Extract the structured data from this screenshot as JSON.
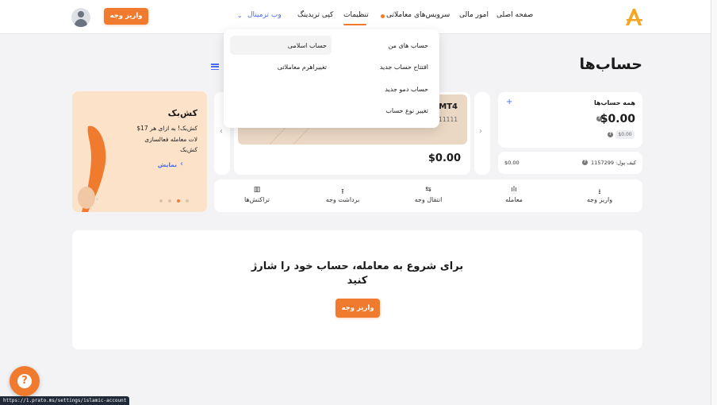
{
  "header": {
    "logo_letter": "A",
    "nav": {
      "home": "صفحه اصلی",
      "finance": "امور مالی",
      "trading_services": "سرویس‌های معاملاتی",
      "settings": "تنظیمات",
      "copy_trading": "کپی تریدینگ",
      "web_terminal": "وب ترمینال"
    },
    "deposit_button": "واریز وجه"
  },
  "page": {
    "title": "حساب‌ها"
  },
  "settings_dropdown": {
    "items_right": [
      "حساب های من",
      "افتتاح حساب جدید",
      "حساب دمو جدید",
      "تغییر نوع حساب"
    ],
    "items_left": [
      "حساب اسلامی",
      "تغییراهرم معاملاتی"
    ]
  },
  "accounts_summary": {
    "title": "همه حساب‌ها",
    "add_symbol": "+",
    "total": "$0.00",
    "chip": "$0.00",
    "wallet_label": "کیف پول: 1157299",
    "wallet_value": "$0.00"
  },
  "account_card": {
    "platform": "MT4",
    "number": "11111",
    "balance": "$0.00"
  },
  "cashback": {
    "title": "کش‌بک",
    "text_line1": "$17 کش‌بک! به ازای هر",
    "text_line2": "لات معامله فعالسازی",
    "text_line3": "کش‌بک",
    "show_link": "نمایش"
  },
  "actions": [
    {
      "label": "واریز وجه",
      "icon": "download-icon"
    },
    {
      "label": "معامله",
      "icon": "candles-icon"
    },
    {
      "label": "انتقال وجه",
      "icon": "transfer-icon"
    },
    {
      "label": "برداشت وجه",
      "icon": "upload-icon"
    },
    {
      "label": "تراکنش‌ها",
      "icon": "trash-icon"
    }
  ],
  "empty_state": {
    "line1": "برای شروع به معامله، حساب خود را شارژ",
    "line2": "کنید",
    "button": "واریز وجه"
  },
  "status_bar_url": "https://1.prato.ms/settings/islamic-account",
  "colors": {
    "accent": "#f07a2e",
    "link": "#4a6cf7"
  }
}
